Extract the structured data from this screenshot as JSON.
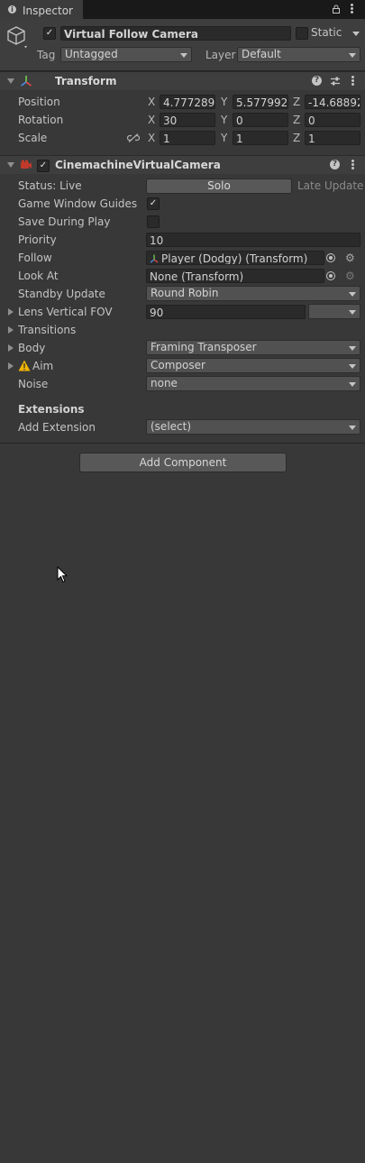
{
  "tab": {
    "title": "Inspector"
  },
  "header": {
    "object_name": "Virtual Follow Camera",
    "static_label": "Static",
    "tag_label": "Tag",
    "tag_value": "Untagged",
    "layer_label": "Layer",
    "layer_value": "Default"
  },
  "transform": {
    "title": "Transform",
    "position_label": "Position",
    "rotation_label": "Rotation",
    "scale_label": "Scale",
    "axis_x": "X",
    "axis_y": "Y",
    "axis_z": "Z",
    "position": {
      "x": "4.777289",
      "y": "5.577992",
      "z": "-14.68892"
    },
    "rotation": {
      "x": "30",
      "y": "0",
      "z": "0"
    },
    "scale": {
      "x": "1",
      "y": "1",
      "z": "1"
    }
  },
  "vcam": {
    "title": "CinemachineVirtualCamera",
    "status_label": "Status: Live",
    "solo_label": "Solo",
    "late_update_label": "Late Update",
    "game_window_guides_label": "Game Window Guides",
    "save_during_play_label": "Save During Play",
    "priority_label": "Priority",
    "priority_value": "10",
    "follow_label": "Follow",
    "follow_value": "Player (Dodgy) (Transform)",
    "look_at_label": "Look At",
    "look_at_value": "None (Transform)",
    "standby_update_label": "Standby Update",
    "standby_update_value": "Round Robin",
    "lens_label": "Lens Vertical FOV",
    "lens_value": "90",
    "transitions_label": "Transitions",
    "body_label": "Body",
    "body_value": "Framing Transposer",
    "aim_label": "Aim",
    "aim_value": "Composer",
    "noise_label": "Noise",
    "noise_value": "none",
    "extensions_label": "Extensions",
    "add_extension_label": "Add Extension",
    "add_extension_value": "(select)"
  },
  "add_component_label": "Add Component",
  "colors": {
    "background": "#383838",
    "header": "#3e3e3e",
    "field": "#2a2a2a",
    "warning": "#f0b400"
  }
}
